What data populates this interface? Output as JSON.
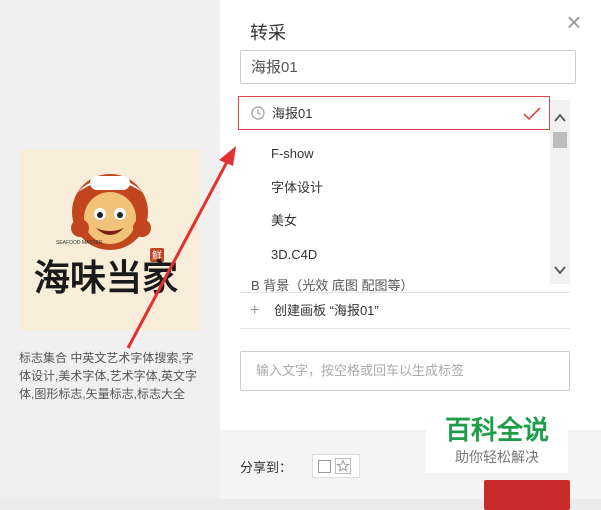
{
  "preview": {
    "logo_text": "海味当家",
    "logo_sub": "SEAFOOD MASTER",
    "logo_seal": "鲜",
    "caption": "标志集合 中英文艺术字体搜索,字体设计,美术字体,艺术字体,英文字体,图形标志,矢量标志,标志大全"
  },
  "dialog": {
    "title": "转采",
    "close_icon": "close-icon",
    "board_input_value": "海报01",
    "boards": [
      {
        "label": "海报01",
        "selected": true
      },
      {
        "label": "F-show"
      },
      {
        "label": "字体设计"
      },
      {
        "label": "美女"
      },
      {
        "label": "3D.C4D"
      }
    ],
    "group_label": "B  背景（光效 底图 配图等）",
    "create_board": "创建画板 “海报01”",
    "tag_placeholder": "输入文字，按空格或回车以生成标签",
    "share_label": "分享到：",
    "accent_color": "#d84a4a"
  },
  "watermark": {
    "title": "百科全说",
    "subtitle": "助你轻松解决"
  }
}
